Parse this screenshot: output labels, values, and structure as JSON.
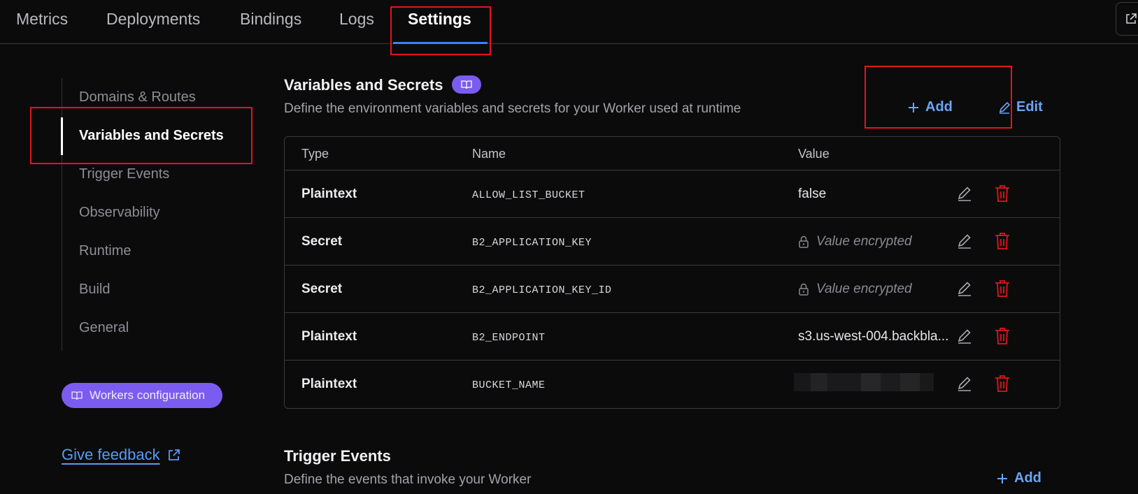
{
  "tabs": [
    {
      "label": "Metrics"
    },
    {
      "label": "Deployments"
    },
    {
      "label": "Bindings"
    },
    {
      "label": "Logs"
    },
    {
      "label": "Settings",
      "active": true
    }
  ],
  "sidebar": {
    "items": [
      {
        "label": "Domains & Routes"
      },
      {
        "label": "Variables and Secrets",
        "active": true
      },
      {
        "label": "Trigger Events"
      },
      {
        "label": "Observability"
      },
      {
        "label": "Runtime"
      },
      {
        "label": "Build"
      },
      {
        "label": "General"
      }
    ],
    "config_pill": "Workers configuration",
    "feedback": "Give feedback"
  },
  "variables": {
    "title": "Variables and Secrets",
    "description": "Define the environment variables and secrets for your Worker used at runtime",
    "add_label": "Add",
    "edit_label": "Edit",
    "columns": [
      "Type",
      "Name",
      "Value"
    ],
    "rows": [
      {
        "type": "Plaintext",
        "name": "ALLOW_LIST_BUCKET",
        "value": "false",
        "encrypted": false
      },
      {
        "type": "Secret",
        "name": "B2_APPLICATION_KEY",
        "value": "Value encrypted",
        "encrypted": true
      },
      {
        "type": "Secret",
        "name": "B2_APPLICATION_KEY_ID",
        "value": "Value encrypted",
        "encrypted": true
      },
      {
        "type": "Plaintext",
        "name": "B2_ENDPOINT",
        "value": "s3.us-west-004.backbla...",
        "encrypted": false
      },
      {
        "type": "Plaintext",
        "name": "BUCKET_NAME",
        "value": "",
        "redacted": true
      }
    ]
  },
  "trigger_events": {
    "title": "Trigger Events",
    "description": "Define the events that invoke your Worker",
    "add_label": "Add"
  },
  "colors": {
    "accent_blue": "#3b82f6",
    "link_blue": "#6aa5f5",
    "purple": "#7b5cf0",
    "danger_red": "#e3151a",
    "background": "#0b0b0c"
  }
}
